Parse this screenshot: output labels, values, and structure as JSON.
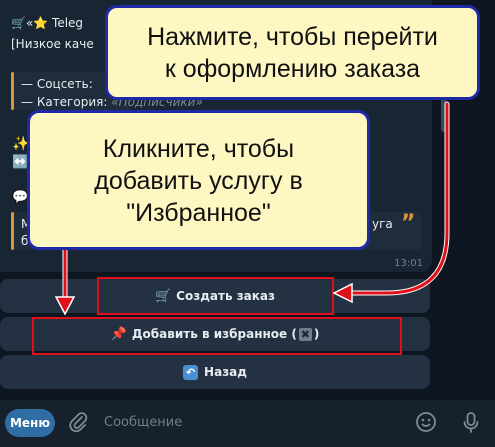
{
  "message": {
    "title_line1": "🛒«⭐ Teleg",
    "title_line2": "[Низкое каче",
    "detail_social_label": "— Соцсеть: ",
    "detail_category_label": "— Категория: ",
    "detail_category_value": "«Подписчики»",
    "partial_left_1": "М",
    "partial_left_2": "б",
    "partial_right": "уга",
    "timestamp": "13:01"
  },
  "keyboard": {
    "create_order_label": "Создать заказ",
    "add_favorite_label": "Добавить в избранное (",
    "add_favorite_suffix": ")",
    "back_label": "Назад"
  },
  "callouts": {
    "top_line1": "Нажмите, чтобы перейти",
    "top_line2": "к оформлению заказа",
    "left_line1": "Кликните, чтобы",
    "left_line2": "добавить услугу в",
    "left_line3": "\"Избранное\""
  },
  "input_bar": {
    "menu_label": "Меню",
    "placeholder": "Сообщение"
  },
  "icons": {
    "cart": "cart-icon",
    "pin": "pushpin-icon",
    "cross": "cross-mark-icon",
    "back": "back-arrow-icon",
    "attach": "paperclip-icon",
    "emoji": "emoji-icon",
    "mic": "microphone-icon"
  },
  "colors": {
    "highlight": "#e0101a",
    "callout_bg": "#fff7c2",
    "callout_border": "#1f2aa8",
    "accent_quote": "#e0943a"
  }
}
